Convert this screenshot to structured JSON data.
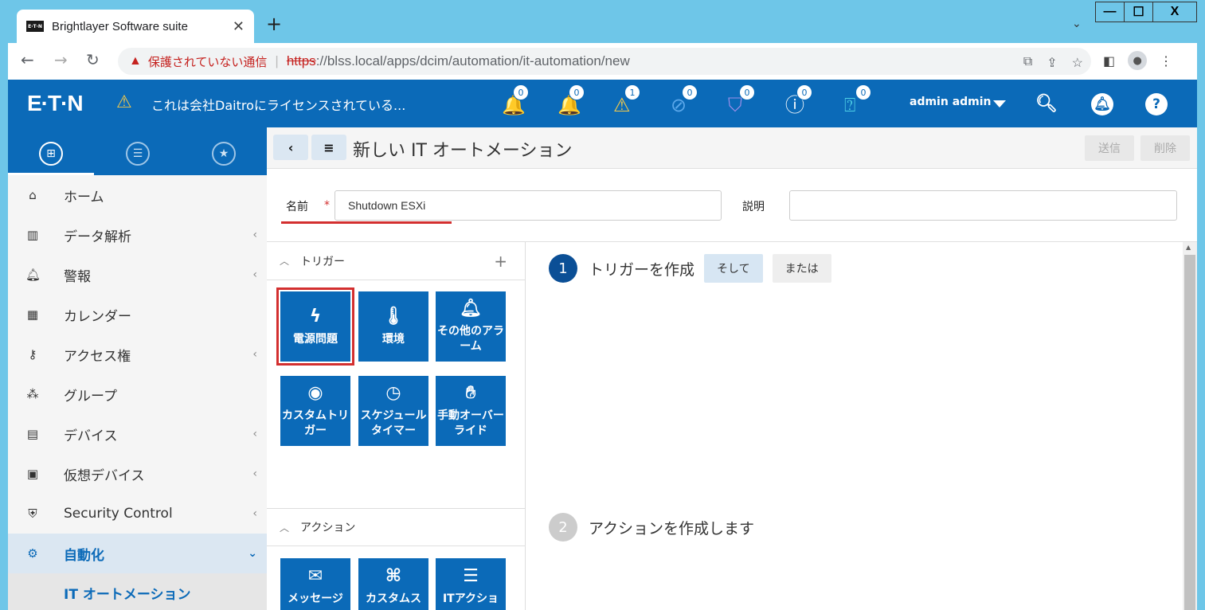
{
  "browser": {
    "tab_title": "Brightlayer Software suite",
    "tab_close": "✕",
    "new_tab": "+",
    "window": {
      "minimize": "—",
      "maximize": "☐",
      "close": "X"
    },
    "security_label": "保護されていない通信",
    "url_scheme": "https",
    "url_rest": "://blss.local/apps/dcim/automation/it-automation/new"
  },
  "header": {
    "logo": "E·T·N",
    "license_text": "これは会社Daitroにライセンスされている...",
    "alarm_counts": [
      "0",
      "0",
      "1",
      "0",
      "0",
      "0",
      "0"
    ],
    "user": "admin admin",
    "colors": {
      "primary": "#0b6ab8",
      "alarm_red": "#e8413b",
      "warn_yellow": "#f2c94c"
    }
  },
  "sidebar": {
    "items": [
      {
        "label": "ホーム",
        "icon": "home-icon",
        "chevron": false
      },
      {
        "label": "データ解析",
        "icon": "chart-icon",
        "chevron": true
      },
      {
        "label": "警報",
        "icon": "alarm-bell-icon",
        "chevron": true
      },
      {
        "label": "カレンダー",
        "icon": "calendar-icon",
        "chevron": false
      },
      {
        "label": "アクセス権",
        "icon": "user-key-icon",
        "chevron": true
      },
      {
        "label": "グループ",
        "icon": "group-icon",
        "chevron": false
      },
      {
        "label": "デバイス",
        "icon": "device-icon",
        "chevron": true
      },
      {
        "label": "仮想デバイス",
        "icon": "virtual-device-icon",
        "chevron": true
      },
      {
        "label": "Security Control",
        "icon": "shield-icon",
        "chevron": true
      },
      {
        "label": "自動化",
        "icon": "gears-icon",
        "chevron": true
      }
    ],
    "sub_item": "IT オートメーション"
  },
  "main": {
    "title": "新しい IT オートメーション",
    "send": "送信",
    "delete": "削除",
    "name_label": "名前",
    "required_mark": "*",
    "name_value": "Shutdown ESXi",
    "desc_label": "説明",
    "desc_value": "",
    "trigger_header": "トリガー",
    "action_header": "アクション",
    "triggers": [
      {
        "label": "電源問題",
        "icon": "lightning-icon"
      },
      {
        "label": "環境",
        "icon": "thermometer-icon"
      },
      {
        "label": "その他のアラーム",
        "icon": "bell-icon"
      },
      {
        "label": "カスタムトリガー",
        "icon": "record-icon"
      },
      {
        "label": "スケジュールタイマー",
        "icon": "clock-icon"
      },
      {
        "label": "手動オーバーライド",
        "icon": "hand-icon"
      }
    ],
    "actions": [
      {
        "label": "メッセージ",
        "icon": "mail-icon"
      },
      {
        "label": "カスタムス",
        "icon": "code-file-icon"
      },
      {
        "label": "ITアクショ",
        "icon": "server-icon"
      }
    ],
    "step1": {
      "num": "1",
      "text": "トリガーを作成",
      "and": "そして",
      "or": "または"
    },
    "step2": {
      "num": "2",
      "text": "アクションを作成します"
    }
  }
}
